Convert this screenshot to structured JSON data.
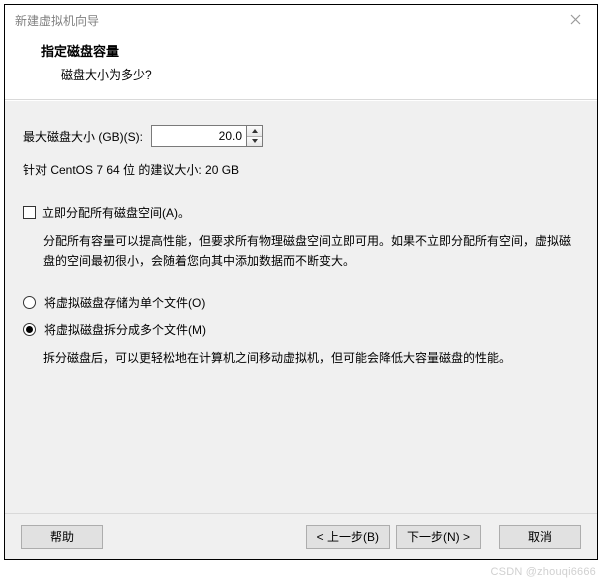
{
  "window": {
    "title": "新建虚拟机向导"
  },
  "header": {
    "title": "指定磁盘容量",
    "subtitle": "磁盘大小为多少?"
  },
  "disk_size": {
    "label": "最大磁盘大小 (GB)(S):",
    "value": "20.0"
  },
  "recommendation": "针对 CentOS 7 64 位 的建议大小: 20 GB",
  "allocate_now": {
    "checked": false,
    "label": "立即分配所有磁盘空间(A)。",
    "description": "分配所有容量可以提高性能，但要求所有物理磁盘空间立即可用。如果不立即分配所有空间，虚拟磁盘的空间最初很小，会随着您向其中添加数据而不断变大。"
  },
  "storage": {
    "single": {
      "label": "将虚拟磁盘存储为单个文件(O)",
      "selected": false
    },
    "split": {
      "label": "将虚拟磁盘拆分成多个文件(M)",
      "selected": true
    },
    "split_description": "拆分磁盘后，可以更轻松地在计算机之间移动虚拟机，但可能会降低大容量磁盘的性能。"
  },
  "buttons": {
    "help": "帮助",
    "back": "< 上一步(B)",
    "next": "下一步(N) >",
    "cancel": "取消"
  },
  "watermark": "CSDN @zhouqi6666"
}
